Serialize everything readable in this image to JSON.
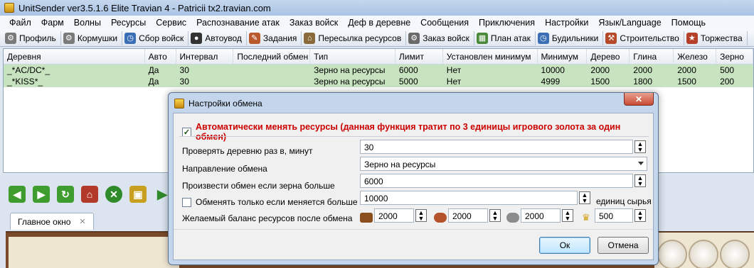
{
  "window": {
    "title": "UnitSender ver3.5.1.6 Elite Travian 4 - Patricii tx2.travian.com"
  },
  "menu": [
    "Файл",
    "Фарм",
    "Волны",
    "Ресурсы",
    "Сервис",
    "Распознавание атак",
    "Заказ войск",
    "Деф в деревне",
    "Сообщения",
    "Приключения",
    "Настройки",
    "Язык/Language",
    "Помощь"
  ],
  "toolbar": [
    {
      "label": "Профиль",
      "icon": "gear-icon",
      "color": "#7a7a7a"
    },
    {
      "label": "Кормушки",
      "icon": "gear-icon",
      "color": "#7a7a7a"
    },
    {
      "label": "Сбор войск",
      "icon": "clock-icon",
      "color": "#3b6fb5"
    },
    {
      "label": "Автоувод",
      "icon": "bomb-icon",
      "color": "#333333"
    },
    {
      "label": "Задания",
      "icon": "note-icon",
      "color": "#b85a2b"
    },
    {
      "label": "Пересылка ресурсов",
      "icon": "house-icon",
      "color": "#8a6a3a"
    },
    {
      "label": "Заказ войск",
      "icon": "gear-icon",
      "color": "#6a6a6a"
    },
    {
      "label": "План атак",
      "icon": "map-icon",
      "color": "#4a8a3a"
    },
    {
      "label": "Будильники",
      "icon": "clock-icon",
      "color": "#3b6fb5"
    },
    {
      "label": "Строительство",
      "icon": "hammer-icon",
      "color": "#b54a2a"
    },
    {
      "label": "Торжества",
      "icon": "party-icon",
      "color": "#b5402a"
    }
  ],
  "table": {
    "columns": [
      "Деревня",
      "Авто",
      "Интервал",
      "Последний обмен",
      "Тип",
      "Лимит",
      "Установлен минимум",
      "Минимум",
      "Дерево",
      "Глина",
      "Железо",
      "Зерно"
    ],
    "rows": [
      [
        "_*AC/DC*_",
        "Да",
        "30",
        "",
        "Зерно на ресурсы",
        "6000",
        "Нет",
        "10000",
        "2000",
        "2000",
        "2000",
        "500"
      ],
      [
        "_*KISS*_",
        "Да",
        "30",
        "",
        "Зерно на ресурсы",
        "5000",
        "Нет",
        "4999",
        "1500",
        "1800",
        "1500",
        "200"
      ]
    ]
  },
  "bottom": {
    "main_tab": "Главное окно",
    "close": "✕"
  },
  "dialog": {
    "title": "Настройки обмена",
    "close": "✕",
    "auto_label": "Автоматически менять ресурсы (данная функция тратит по 3 единицы игрового золота за один обмен)",
    "auto_checked": true,
    "check_label": "Проверять деревню раз в, минут",
    "check_value": "30",
    "direction_label": "Направление обмена",
    "direction_value": "Зерно на ресурсы",
    "exchange_label": "Произвести обмен если зерна больше",
    "exchange_value": "6000",
    "only_if_label": "Обменять только если меняется больше",
    "only_if_checked": false,
    "only_if_value": "10000",
    "units_label": "единиц сырья",
    "balance_label": "Желаемый баланс ресурсов после обмена",
    "balance": [
      {
        "resource": "wood",
        "value": "2000"
      },
      {
        "resource": "clay",
        "value": "2000"
      },
      {
        "resource": "iron",
        "value": "2000"
      },
      {
        "resource": "crop",
        "value": "500"
      }
    ],
    "ok_label": "Ок",
    "cancel_label": "Отмена"
  }
}
